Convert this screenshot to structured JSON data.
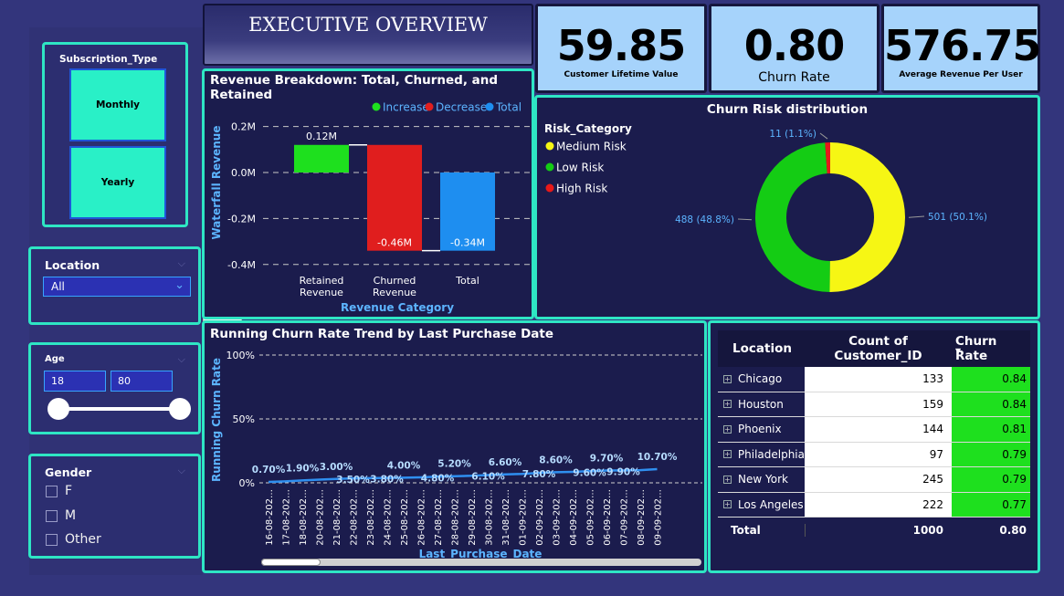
{
  "title": "EXECUTIVE OVERVIEW",
  "slicers": {
    "subscription": {
      "title": "Subscription_Type",
      "options": [
        "Monthly",
        "Yearly"
      ]
    },
    "location": {
      "title": "Location",
      "selected": "All"
    },
    "age": {
      "title": "Age",
      "min": "18",
      "max": "80"
    },
    "gender": {
      "title": "Gender",
      "options": [
        "F",
        "M",
        "Other"
      ]
    }
  },
  "kpis": [
    {
      "value": "59.85",
      "label": "Customer Lifetime Value"
    },
    {
      "value": "0.80",
      "label": "Churn Rate"
    },
    {
      "value": "576.75",
      "label": "Average Revenue Per User"
    }
  ],
  "colors": {
    "increase": "#1ee01e",
    "decrease": "#e01e1e",
    "total": "#1e8ef0",
    "medium": "#f6f614",
    "low": "#14cc14",
    "high": "#e81818",
    "accent": "#2ee6c4"
  },
  "waterfall": {
    "title": "Revenue Breakdown: Total, Churned, and Retained",
    "legend": [
      "Increase",
      "Decrease",
      "Total"
    ],
    "chart_data": {
      "type": "bar",
      "categories": [
        [
          "Retained",
          "Revenue"
        ],
        [
          "Churned",
          "Revenue"
        ],
        [
          "Total"
        ]
      ],
      "values": [
        0.12,
        -0.46,
        -0.34
      ],
      "value_labels": [
        "0.12M",
        "-0.46M",
        "-0.34M"
      ],
      "kinds": [
        "increase",
        "decrease",
        "total"
      ],
      "yticks": [
        "0.2M",
        "0.0M",
        "-0.2M",
        "-0.4M"
      ],
      "ytick_values": [
        0.2,
        0.0,
        -0.2,
        -0.4
      ],
      "ylabel": "Waterfall Revenue",
      "xlabel": "Revenue Category"
    }
  },
  "donut": {
    "title": "Churn Risk distribution",
    "legend_title": "Risk_Category",
    "chart_data": {
      "type": "pie",
      "categories": [
        "Medium Risk",
        "Low Risk",
        "High Risk"
      ],
      "values": [
        501,
        488,
        11
      ],
      "labels": [
        "501 (50.1%)",
        "488 (48.8%)",
        "11 (1.1%)"
      ]
    }
  },
  "trend": {
    "title": "Running Churn Rate Trend by Last Purchase Date",
    "chart_data": {
      "type": "line",
      "x": [
        "16-08-202…",
        "17-08-202…",
        "18-08-202…",
        "20-08-202…",
        "21-08-202…",
        "22-08-202…",
        "23-08-202…",
        "24-08-202…",
        "25-08-202…",
        "26-08-202…",
        "27-08-202…",
        "28-08-202…",
        "29-08-202…",
        "30-08-202…",
        "31-08-202…",
        "01-09-202…",
        "02-09-202…",
        "03-09-202…",
        "04-09-202…",
        "05-09-202…",
        "06-09-202…",
        "07-09-202…",
        "08-09-202…",
        "09-09-202…"
      ],
      "values": [
        0.7,
        1.2,
        1.9,
        2.5,
        3.0,
        3.5,
        3.7,
        3.8,
        4.0,
        4.3,
        4.8,
        5.2,
        5.5,
        6.1,
        6.6,
        7.0,
        7.8,
        8.3,
        8.6,
        9.1,
        9.6,
        9.7,
        9.9,
        10.7
      ],
      "point_labels": [
        {
          "i": 0,
          "text": "0.70%",
          "pos": "above"
        },
        {
          "i": 2,
          "text": "1.90%",
          "pos": "above"
        },
        {
          "i": 4,
          "text": "3.00%",
          "pos": "above"
        },
        {
          "i": 5,
          "text": "3.50%",
          "pos": "below"
        },
        {
          "i": 7,
          "text": "3.80%",
          "pos": "below"
        },
        {
          "i": 8,
          "text": "4.00%",
          "pos": "above"
        },
        {
          "i": 10,
          "text": "4.80%",
          "pos": "below"
        },
        {
          "i": 11,
          "text": "5.20%",
          "pos": "above"
        },
        {
          "i": 13,
          "text": "6.10%",
          "pos": "below"
        },
        {
          "i": 14,
          "text": "6.60%",
          "pos": "above"
        },
        {
          "i": 16,
          "text": "7.80%",
          "pos": "below"
        },
        {
          "i": 17,
          "text": "8.60%",
          "pos": "above"
        },
        {
          "i": 19,
          "text": "9.60%",
          "pos": "below"
        },
        {
          "i": 20,
          "text": "9.70%",
          "pos": "above"
        },
        {
          "i": 21,
          "text": "9.90%",
          "pos": "below"
        },
        {
          "i": 23,
          "text": "10.70%",
          "pos": "above"
        }
      ],
      "yticks": [
        "100%",
        "50%",
        "0%"
      ],
      "ytick_values": [
        100,
        50,
        0
      ],
      "ylabel": "Running Churn Rate",
      "xlabel": "Last_Purchase_Date"
    }
  },
  "table": {
    "headers": [
      "Location",
      "Count of Customer_ID",
      "Churn Rate"
    ],
    "rows": [
      [
        "Chicago",
        "133",
        "0.84"
      ],
      [
        "Houston",
        "159",
        "0.84"
      ],
      [
        "Phoenix",
        "144",
        "0.81"
      ],
      [
        "Philadelphia",
        "97",
        "0.79"
      ],
      [
        "New York",
        "245",
        "0.79"
      ],
      [
        "Los Angeles",
        "222",
        "0.77"
      ]
    ],
    "total": [
      "Total",
      "1000",
      "0.80"
    ]
  }
}
